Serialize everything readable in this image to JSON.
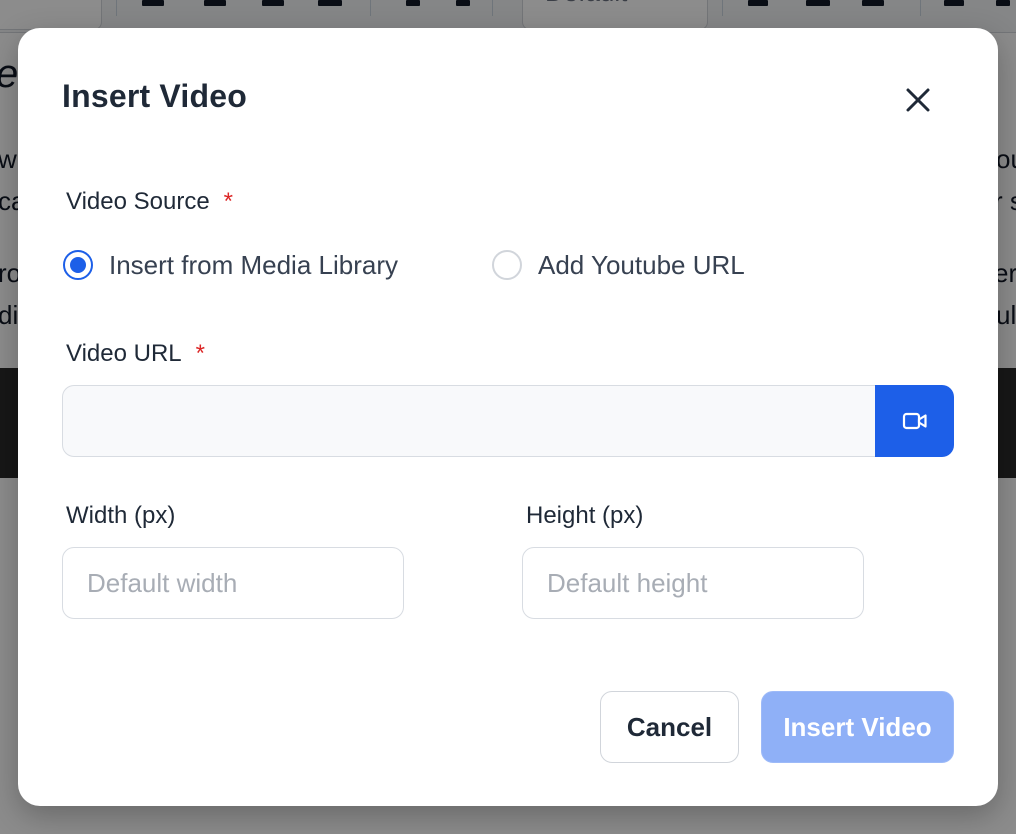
{
  "background": {
    "select_value": "Default",
    "heading_fragment": "et",
    "left_fragments": [
      "w",
      "ca",
      "ro",
      "di"
    ],
    "right_fragments": [
      "ou",
      "r s",
      "era",
      "ul"
    ]
  },
  "modal": {
    "title": "Insert Video",
    "video_source": {
      "label": "Video Source",
      "required_mark": "*",
      "options": [
        {
          "label": "Insert from Media Library",
          "checked": true
        },
        {
          "label": "Add Youtube URL",
          "checked": false
        }
      ]
    },
    "video_url": {
      "label": "Video URL",
      "required_mark": "*",
      "value": "",
      "placeholder": ""
    },
    "width": {
      "label": "Width (px)",
      "placeholder": "Default width",
      "value": ""
    },
    "height": {
      "label": "Height (px)",
      "placeholder": "Default height",
      "value": ""
    },
    "buttons": {
      "cancel": "Cancel",
      "insert": "Insert Video"
    },
    "colors": {
      "primary": "#1d5fe8",
      "primary_disabled": "#8fb0f7",
      "required": "#dc2626"
    }
  }
}
